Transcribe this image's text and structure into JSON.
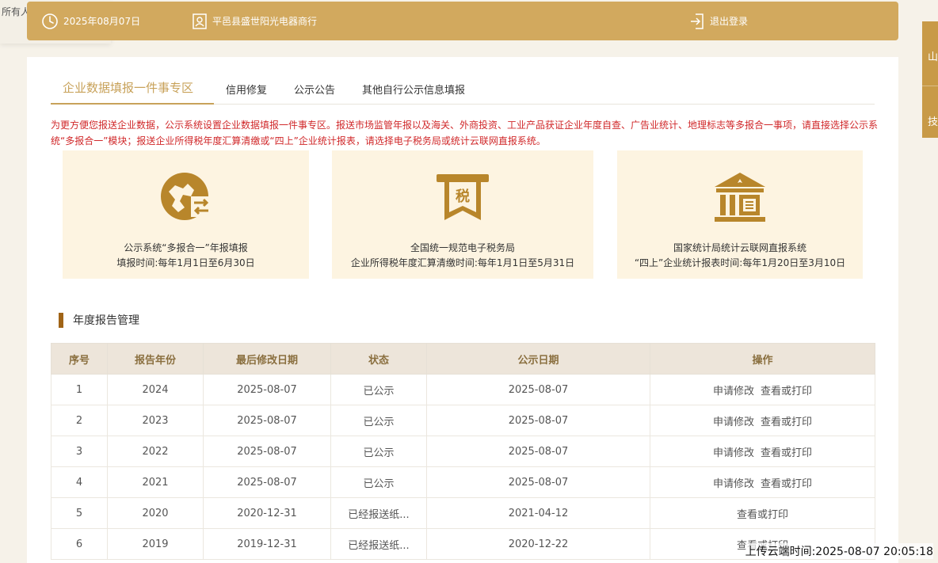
{
  "owner_label": "所有人",
  "header": {
    "date": "2025年08月07日",
    "company": "平邑县盛世阳光电器商行",
    "logout": "退出登录"
  },
  "side_nav": [
    "山",
    "技"
  ],
  "tabs": [
    {
      "label": "企业数据填报一件事专区",
      "active": true
    },
    {
      "label": "信用修复",
      "active": false
    },
    {
      "label": "公示公告",
      "active": false
    },
    {
      "label": "其他自行公示信息填报",
      "active": false
    }
  ],
  "notice": "为更方便您报送企业数据，公示系统设置企业数据填报一件事专区。报送市场监管年报以及海关、外商投资、工业产品获证企业年度自查、广告业统计、地理标志等多报合一事项，请直接选择公示系统“多报合一”模块；报送企业所得税年度汇算清缴或“四上”企业统计报表，请选择电子税务局或统计云联网直报系统。",
  "cards": [
    {
      "icon": "map-exchange-icon",
      "title": "公示系统“多报合一”年报填报",
      "subtitle": "填报时间:每年1月1日至6月30日"
    },
    {
      "icon": "tax-ticket-icon",
      "title": "全国统一规范电子税务局",
      "subtitle": "企业所得税年度汇算清缴时间:每年1月1日至5月31日"
    },
    {
      "icon": "bank-building-icon",
      "title": "国家统计局统计云联网直报系统",
      "subtitle": "“四上”企业统计报表时间:每年1月20日至3月10日"
    }
  ],
  "section_title": "年度报告管理",
  "table": {
    "headers": [
      "序号",
      "报告年份",
      "最后修改日期",
      "状态",
      "公示日期",
      "操作"
    ],
    "rows": [
      {
        "no": "1",
        "year": "2024",
        "modified": "2025-08-07",
        "status": "已公示",
        "published": "2025-08-07",
        "actions": [
          "申请修改",
          "查看或打印"
        ]
      },
      {
        "no": "2",
        "year": "2023",
        "modified": "2025-08-07",
        "status": "已公示",
        "published": "2025-08-07",
        "actions": [
          "申请修改",
          "查看或打印"
        ]
      },
      {
        "no": "3",
        "year": "2022",
        "modified": "2025-08-07",
        "status": "已公示",
        "published": "2025-08-07",
        "actions": [
          "申请修改",
          "查看或打印"
        ]
      },
      {
        "no": "4",
        "year": "2021",
        "modified": "2025-08-07",
        "status": "已公示",
        "published": "2025-08-07",
        "actions": [
          "申请修改",
          "查看或打印"
        ]
      },
      {
        "no": "5",
        "year": "2020",
        "modified": "2020-12-31",
        "status": "已经报送纸...",
        "published": "2021-04-12",
        "actions": [
          "查看或打印"
        ]
      },
      {
        "no": "6",
        "year": "2019",
        "modified": "2019-12-31",
        "status": "已经报送纸...",
        "published": "2020-12-22",
        "actions": [
          "查看或打印"
        ]
      }
    ]
  },
  "upload_time": "上传云端时间:2025-08-07 20:05:18",
  "colors": {
    "brand": "#d2a95e",
    "notice": "#d0282a",
    "card_bg": "#fdf4e1",
    "icon": "#b8862b"
  }
}
